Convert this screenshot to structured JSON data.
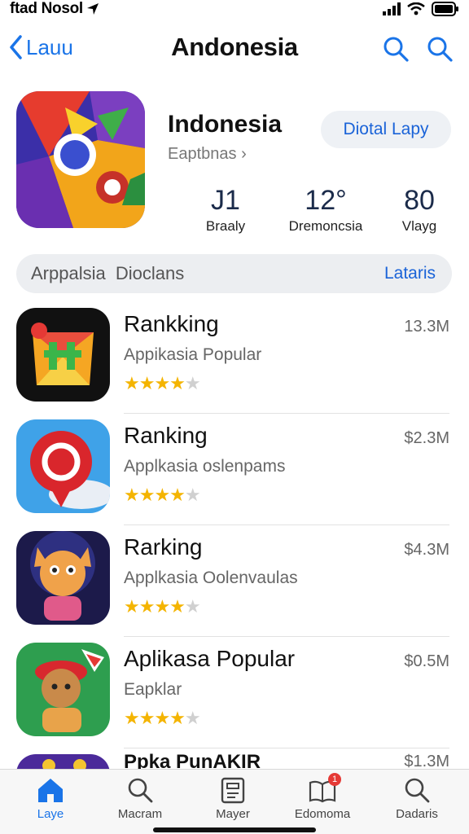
{
  "status_bar": {
    "carrier": "ftad Nosol"
  },
  "nav": {
    "back_label": "Lauu",
    "title": "Andonesia",
    "icons": [
      "search-icon",
      "search-icon"
    ]
  },
  "hero": {
    "app_name": "Indonesia",
    "subtitle": "Eaptbnas ›",
    "button_label": "Diotal Lapy",
    "stats": [
      {
        "value": "Ј1",
        "label": "Braaly"
      },
      {
        "value": "12°",
        "label": "Dremoncsia"
      },
      {
        "value": "80",
        "label": "Vlayg"
      }
    ]
  },
  "segment": {
    "left_label": "Arppalsia Dioclans",
    "right_label": "Lataris"
  },
  "apps": [
    {
      "title": "Rankking",
      "subtitle": "Appikasia Popular",
      "price": "13.3M",
      "rating": 3.5
    },
    {
      "title": "Ranking",
      "subtitle": "Applkasia oslenpams",
      "price": "$2.3M",
      "rating": 3.5
    },
    {
      "title": "Rarking",
      "subtitle": "Applkasia Oolenvaulas",
      "price": "$4.3M",
      "rating": 3.5
    },
    {
      "title": "Aplikasa Popular",
      "subtitle": "Eapklar",
      "price": "$0.5M",
      "rating": 3.5
    },
    {
      "title": "Ppka PunAKIR",
      "subtitle": "",
      "price": "$1.3M",
      "rating": 3.5
    }
  ],
  "tabs": [
    {
      "label": "Laye",
      "icon": "home-icon",
      "active": true
    },
    {
      "label": "Macram",
      "icon": "search-icon",
      "active": false
    },
    {
      "label": "Mayer",
      "icon": "document-icon",
      "active": false
    },
    {
      "label": "Edomoma",
      "icon": "book-icon",
      "active": false,
      "badge": "1"
    },
    {
      "label": "Dadaris",
      "icon": "search-icon",
      "active": false
    }
  ],
  "colors": {
    "accent": "#1a74e8",
    "star": "#f4b400",
    "badge": "#e53935"
  }
}
